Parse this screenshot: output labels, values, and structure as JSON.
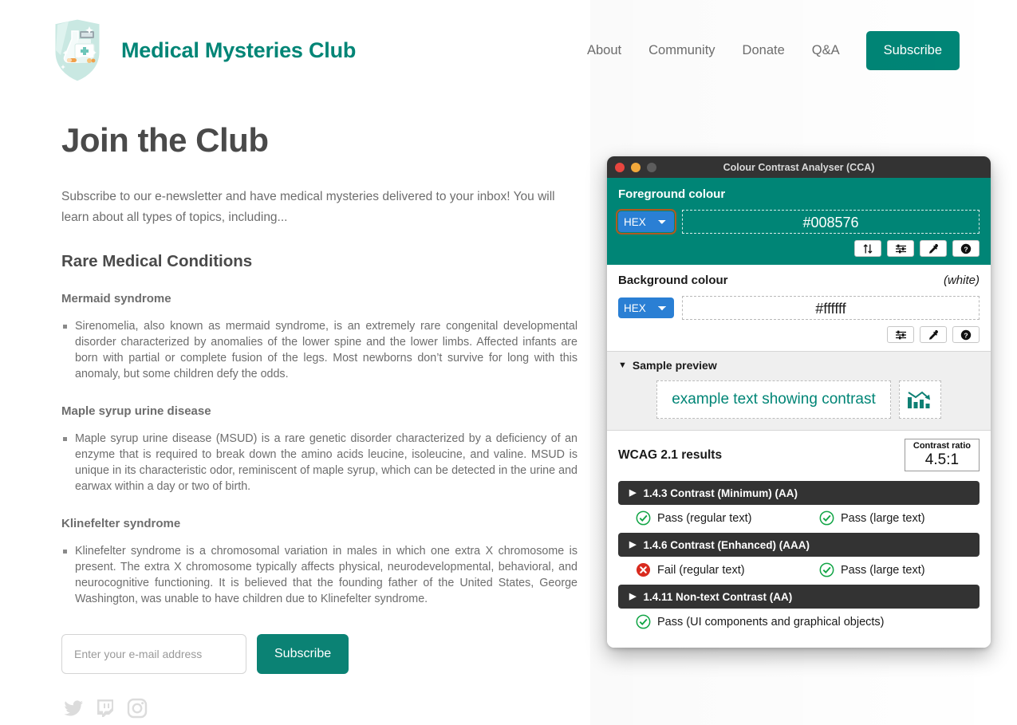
{
  "site": {
    "brand_title": "Medical Mysteries Club",
    "logo_icon": "shield-badge-lab-icon",
    "nav": [
      {
        "label": "About",
        "name": "nav-link-about"
      },
      {
        "label": "Community",
        "name": "nav-link-community"
      },
      {
        "label": "Donate",
        "name": "nav-link-donate"
      },
      {
        "label": "Q&A",
        "name": "nav-link-qa"
      }
    ],
    "cta_label": "Subscribe",
    "accent_color": "#008576"
  },
  "page": {
    "title": "Join the Club",
    "intro": "Subscribe to our e-newsletter and have medical mysteries delivered to your inbox! You will learn about all types of topics, including...",
    "section_title": "Rare Medical Conditions",
    "conditions": [
      {
        "name": "Mermaid syndrome",
        "body": "Sirenomelia, also known as mermaid syndrome, is an extremely rare congenital developmental disorder characterized by anomalies of the lower spine and the lower limbs. Affected infants are born with partial or complete fusion of the legs. Most newborns don’t survive for long with this anomaly, but some children defy the odds."
      },
      {
        "name": "Maple syrup urine disease",
        "body": "Maple syrup urine disease (MSUD) is a rare genetic disorder characterized by a deficiency of an enzyme that is required to break down the amino acids leucine, isoleucine, and valine. MSUD is unique in its characteristic odor, reminiscent of maple syrup, which can be detected in the urine and earwax within a day or two of birth."
      },
      {
        "name": "Klinefelter syndrome",
        "body": "Klinefelter syndrome is a chromosomal variation in males in which one extra X chromosome is present. The extra X chromosome typically affects physical, neurodevelopmental, behavioral, and neurocognitive functioning. It is believed that the founding father of the United States, George Washington, was unable to have children due to Klinefelter syndrome."
      }
    ],
    "form": {
      "email_placeholder": "Enter your e-mail address",
      "email_value": "",
      "submit_label": "Subscribe"
    },
    "social": [
      {
        "name": "twitter-icon",
        "label": "Twitter"
      },
      {
        "name": "twitch-icon",
        "label": "Twitch"
      },
      {
        "name": "instagram-icon",
        "label": "Instagram"
      }
    ]
  },
  "cca": {
    "window_title": "Colour Contrast Analyser (CCA)",
    "traffic_lights": [
      "close",
      "minimise",
      "zoom"
    ],
    "foreground": {
      "label": "Foreground colour",
      "format": "HEX",
      "value": "#008576",
      "panel_color": "#008576",
      "tools": [
        "swap-colours-icon",
        "sliders-icon",
        "eyedropper-icon",
        "help-icon"
      ]
    },
    "background": {
      "label": "Background colour",
      "colour_name": "(white)",
      "format": "HEX",
      "value": "#ffffff",
      "tools": [
        "sliders-icon",
        "eyedropper-icon",
        "help-icon"
      ]
    },
    "preview": {
      "label": "Sample preview",
      "sample_text": "example text showing contrast",
      "graphic_icon": "bar-chart-declining-icon"
    },
    "results": {
      "heading": "WCAG 2.1 results",
      "ratio_label": "Contrast ratio",
      "ratio_value": "4.5:1",
      "criteria": [
        {
          "title": "1.4.3 Contrast (Minimum) (AA)",
          "results": [
            {
              "status": "pass",
              "text": "Pass (regular text)"
            },
            {
              "status": "pass",
              "text": "Pass (large text)"
            }
          ]
        },
        {
          "title": "1.4.6 Contrast (Enhanced) (AAA)",
          "results": [
            {
              "status": "fail",
              "text": "Fail (regular text)"
            },
            {
              "status": "pass",
              "text": "Pass (large text)"
            }
          ]
        },
        {
          "title": "1.4.11 Non-text Contrast (AA)",
          "results": [
            {
              "status": "pass",
              "text": "Pass (UI components and graphical objects)"
            }
          ]
        }
      ]
    }
  }
}
